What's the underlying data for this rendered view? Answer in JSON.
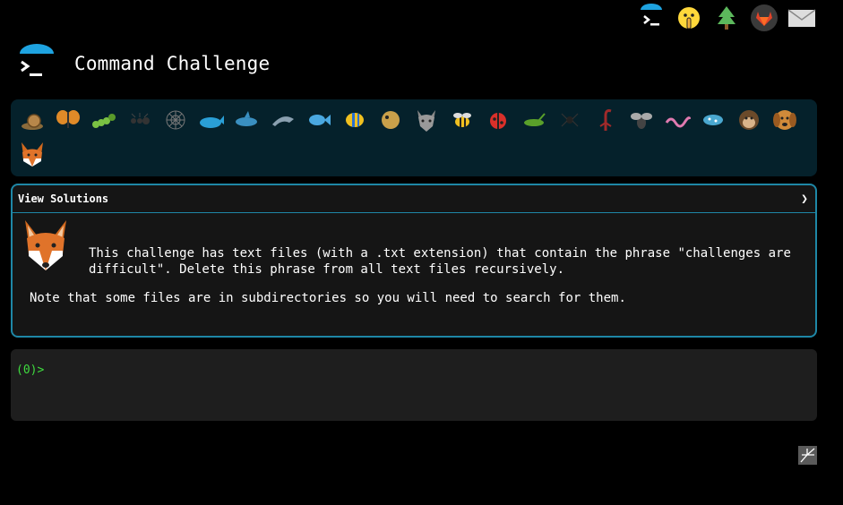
{
  "header": {
    "title": "Command Challenge"
  },
  "top_icons": [
    {
      "name": "terminal-icon"
    },
    {
      "name": "shushing-face-icon"
    },
    {
      "name": "evergreen-tree-icon"
    },
    {
      "name": "gitlab-icon"
    },
    {
      "name": "envelope-icon"
    }
  ],
  "animals": [
    "snail-icon",
    "butterfly-icon",
    "caterpillar-icon",
    "ant-icon",
    "spider-web-icon",
    "whale-icon",
    "shark-icon",
    "dolphin-icon",
    "fish-icon",
    "tropical-fish-icon",
    "blowfish-icon",
    "wolf-icon",
    "bee-icon",
    "ladybug-icon",
    "cricket-icon",
    "spider-icon",
    "scorpion-icon",
    "fly-icon",
    "worm-icon",
    "microbe-icon",
    "monkey-icon",
    "dog-icon",
    "fox-icon"
  ],
  "panel": {
    "header_label": "View Solutions",
    "description": "This challenge has text files (with a .txt extension) that contain the phrase \"challenges are difficult\". Delete this phrase from all text files recursively.",
    "note": "Note that some files are in subdirectories so you will need to search for them."
  },
  "terminal": {
    "prompt": "(0)>"
  },
  "colors": {
    "background": "#000000",
    "strip": "#05212b",
    "panel_border": "#1e87a6",
    "prompt_green": "#3fdc3f"
  }
}
